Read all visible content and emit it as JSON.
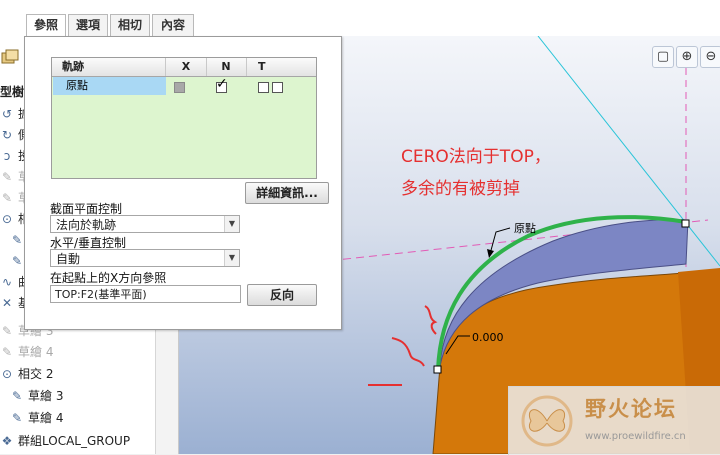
{
  "tabs": [
    {
      "label": "參照",
      "active": true
    },
    {
      "label": "選項",
      "active": false
    },
    {
      "label": "相切",
      "active": false
    },
    {
      "label": "內容",
      "active": false
    }
  ],
  "tree": {
    "header_fragment": "型樹",
    "items": [
      {
        "label": "拡",
        "icon": "sweep-icon",
        "dim": false
      },
      {
        "label": "側",
        "icon": "datum-icon",
        "dim": false
      },
      {
        "label": "投",
        "icon": "projection-icon",
        "dim": false
      },
      {
        "label": "草",
        "icon": "sketch-icon",
        "dim": true
      },
      {
        "label": "草",
        "icon": "sketch-icon",
        "dim": true
      },
      {
        "label": "相",
        "icon": "intersect-icon",
        "dim": false
      },
      {
        "label": "",
        "icon": "sketch-icon",
        "dim": false
      },
      {
        "label": "",
        "icon": "sketch-icon",
        "dim": false
      },
      {
        "label": "曲",
        "icon": "curve-icon",
        "dim": false
      },
      {
        "label": "基",
        "icon": "datum-plane-icon",
        "dim": false
      },
      {
        "label": "草繪 3",
        "icon": "sketch-icon",
        "dim": true
      },
      {
        "label": "草繪 4",
        "icon": "sketch-icon",
        "dim": true
      },
      {
        "label": "相交 2",
        "icon": "intersect-icon",
        "dim": false
      },
      {
        "label": "草繪 3",
        "icon": "sketch-icon",
        "dim": false
      },
      {
        "label": "草繪 4",
        "icon": "sketch-icon",
        "dim": false
      },
      {
        "label": "群組LOCAL_GROUP",
        "icon": "group-icon",
        "dim": false
      }
    ]
  },
  "panel": {
    "table": {
      "headers": [
        "軌跡",
        "X",
        "N",
        "T"
      ],
      "rows": [
        {
          "name": "原點",
          "x": "unchecked-disabled",
          "n": "checked",
          "t": "two-boxes"
        }
      ]
    },
    "details_button": "詳細資訊...",
    "section_plane_label": "截面平面控制",
    "section_plane_value": "法向於軌跡",
    "horiz_vert_label": "水平/垂直控制",
    "horiz_vert_value": "自動",
    "x_ref_label": "在起點上的X方向參照",
    "x_ref_value": "TOP:F2(基準平面)",
    "flip_button": "反向"
  },
  "annotation": {
    "line1": "CERO法向于TOP，",
    "line2": "多余的有被剪掉",
    "color": "#e53030"
  },
  "scene": {
    "origin_label": "原點",
    "dim_label": "0.000",
    "curve_color": "#2fb24a",
    "solid_color": "#d4780a",
    "top_face_color": "#7c86c4"
  },
  "watermark": {
    "title": "野火论坛",
    "url": "www.proewildfire.cn"
  },
  "view_toolbar": [
    "zoom-fit-icon",
    "zoom-in-icon",
    "zoom-out-icon"
  ]
}
